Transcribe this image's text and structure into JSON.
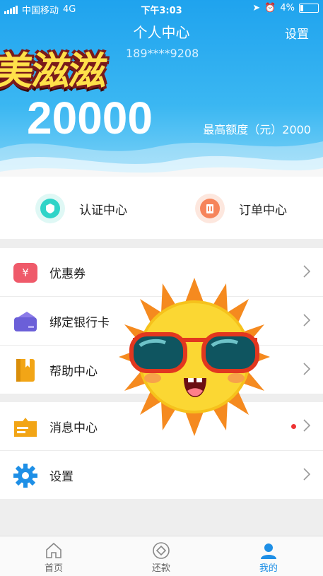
{
  "status_bar": {
    "carrier": "中国移动",
    "network": "4G",
    "time": "下午3:03",
    "battery": "4%"
  },
  "header": {
    "title": "个人中心",
    "settings_label": "设置",
    "phone": "189****9208",
    "sticker_text": "美滋滋"
  },
  "credit": {
    "amount": "20000",
    "limit_text": "最高额度（元）2000"
  },
  "quick_actions": [
    {
      "label": "认证中心",
      "icon": "certificate-icon",
      "color": "#2fd4c8"
    },
    {
      "label": "订单中心",
      "icon": "order-icon",
      "color": "#f6845a"
    }
  ],
  "menu_group1": [
    {
      "label": "优惠券",
      "icon": "coupon-icon"
    },
    {
      "label": "绑定银行卡",
      "icon": "bank-card-icon"
    },
    {
      "label": "帮助中心",
      "icon": "help-book-icon"
    }
  ],
  "menu_group2": [
    {
      "label": "消息中心",
      "icon": "message-icon",
      "has_dot": true
    },
    {
      "label": "设置",
      "icon": "gear-icon"
    }
  ],
  "tabs": [
    {
      "label": "首页",
      "icon": "home-icon"
    },
    {
      "label": "还款",
      "icon": "repay-icon"
    },
    {
      "label": "我的",
      "icon": "user-icon",
      "active": true
    }
  ],
  "colors": {
    "accent": "#1e8fe6",
    "header_blue": "#2aa8ef",
    "badge_red": "#e33333"
  }
}
